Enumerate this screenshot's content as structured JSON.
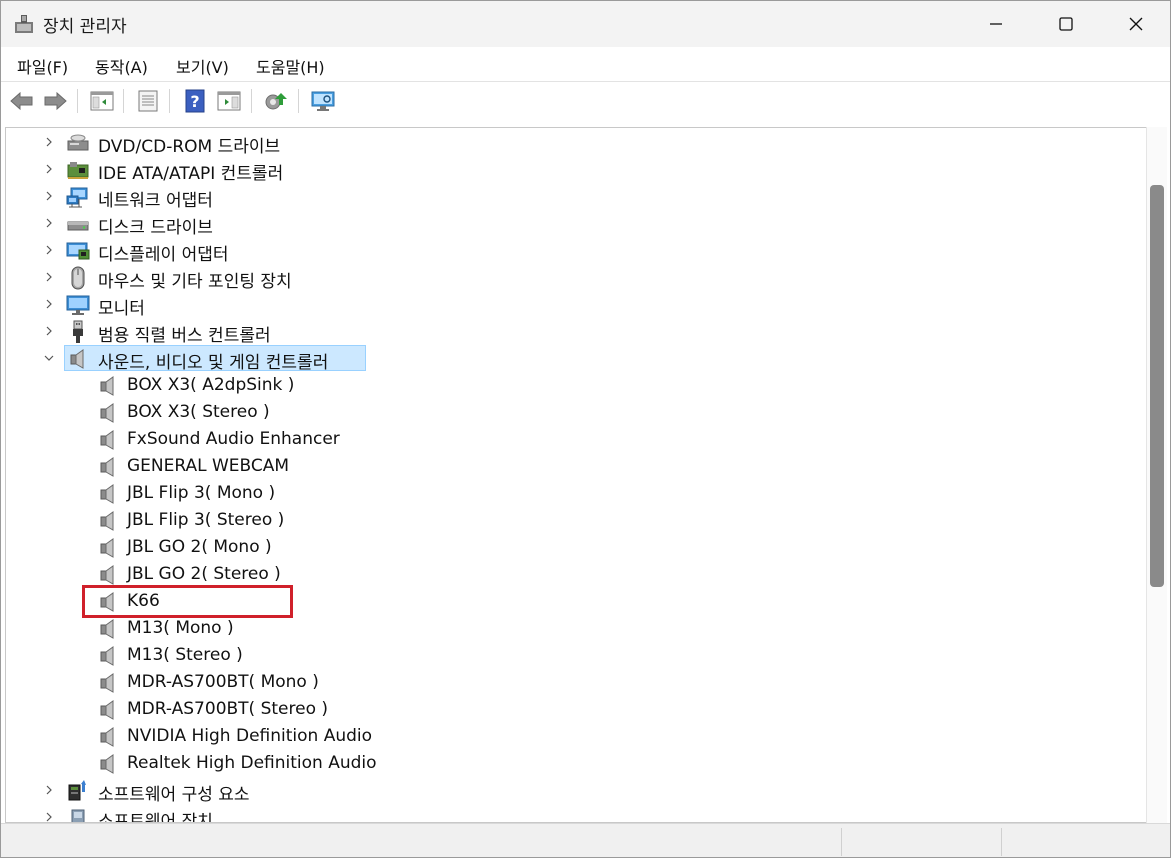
{
  "window": {
    "title": "장치 관리자",
    "controls": {
      "minimize": "minimize-icon",
      "maximize": "maximize-icon",
      "close": "close-icon"
    }
  },
  "menu": [
    {
      "id": "file",
      "label": "파일(F)"
    },
    {
      "id": "action",
      "label": "동작(A)"
    },
    {
      "id": "view",
      "label": "보기(V)"
    },
    {
      "id": "help",
      "label": "도움말(H)"
    }
  ],
  "toolbar": [
    {
      "id": "back",
      "icon": "back-arrow-icon"
    },
    {
      "id": "forward",
      "icon": "forward-arrow-icon"
    },
    {
      "id": "show-hide-console-tree",
      "icon": "console-tree-icon"
    },
    {
      "id": "properties",
      "icon": "properties-icon"
    },
    {
      "id": "help",
      "icon": "help-icon"
    },
    {
      "id": "action-pane",
      "icon": "action-pane-icon"
    },
    {
      "id": "update-driver",
      "icon": "update-driver-icon"
    },
    {
      "id": "scan-hardware",
      "icon": "scan-hardware-icon"
    }
  ],
  "tree": {
    "categories_before": [
      {
        "label": "DVD/CD-ROM 드라이브",
        "icon": "dvd-drive-icon"
      },
      {
        "label": "IDE ATA/ATAPI 컨트롤러",
        "icon": "ide-controller-icon"
      },
      {
        "label": "네트워크 어댑터",
        "icon": "network-adapter-icon"
      },
      {
        "label": "디스크 드라이브",
        "icon": "disk-drive-icon"
      },
      {
        "label": "디스플레이 어댑터",
        "icon": "display-adapter-icon"
      },
      {
        "label": "마우스 및 기타 포인팅 장치",
        "icon": "mouse-icon"
      },
      {
        "label": "모니터",
        "icon": "monitor-icon"
      },
      {
        "label": "범용 직렬 버스 컨트롤러",
        "icon": "usb-icon"
      }
    ],
    "expanded_category": {
      "label": "사운드, 비디오 및 게임 컨트롤러",
      "icon": "speaker-icon"
    },
    "children": [
      "BOX X3( A2dpSink )",
      "BOX X3( Stereo )",
      "FxSound Audio Enhancer",
      "GENERAL WEBCAM",
      "JBL Flip 3( Mono )",
      "JBL Flip 3( Stereo )",
      "JBL GO 2( Mono )",
      "JBL GO 2( Stereo )",
      "K66",
      "M13( Mono )",
      "M13( Stereo )",
      "MDR-AS700BT( Mono )",
      "MDR-AS700BT( Stereo )",
      "NVIDIA High Definition Audio",
      "Realtek High Definition Audio"
    ],
    "highlighted_child": "K66",
    "categories_after": [
      {
        "label": "소프트웨어 구성 요소",
        "icon": "software-component-icon"
      },
      {
        "label": "소프트웨어 장치",
        "icon": "software-device-icon"
      }
    ]
  },
  "colors": {
    "selection": "#cce8ff",
    "highlight_border": "#d0202a"
  }
}
